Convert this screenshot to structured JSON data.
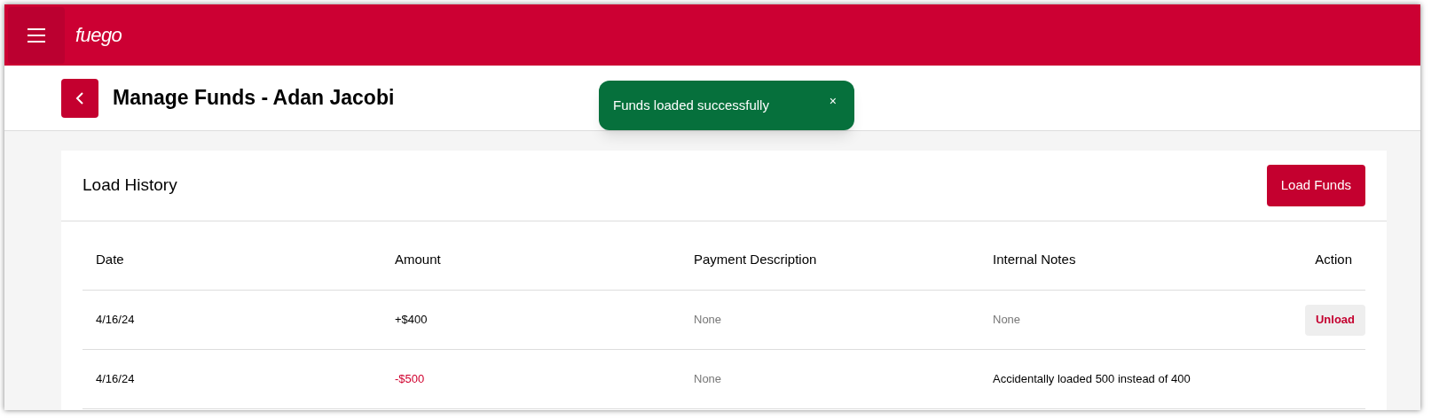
{
  "header": {
    "logo": "fuego"
  },
  "page": {
    "title": "Manage Funds - Adan Jacobi"
  },
  "toast": {
    "message": "Funds loaded successfully",
    "close": "×"
  },
  "card": {
    "title": "Load History",
    "button": "Load Funds"
  },
  "table": {
    "columns": [
      "Date",
      "Amount",
      "Payment Description",
      "Internal Notes",
      "Action"
    ],
    "rows": [
      {
        "date": "4/16/24",
        "amount": {
          "text": "+$400",
          "kind": "credit"
        },
        "description": {
          "text": "None",
          "muted": true
        },
        "notes": {
          "text": "None",
          "muted": true
        },
        "action": "Unload"
      },
      {
        "date": "4/16/24",
        "amount": {
          "text": "-$500",
          "kind": "debit"
        },
        "description": {
          "text": "None",
          "muted": true
        },
        "notes": {
          "text": "Accidentally loaded 500 instead of 400",
          "muted": false
        }
      }
    ]
  }
}
